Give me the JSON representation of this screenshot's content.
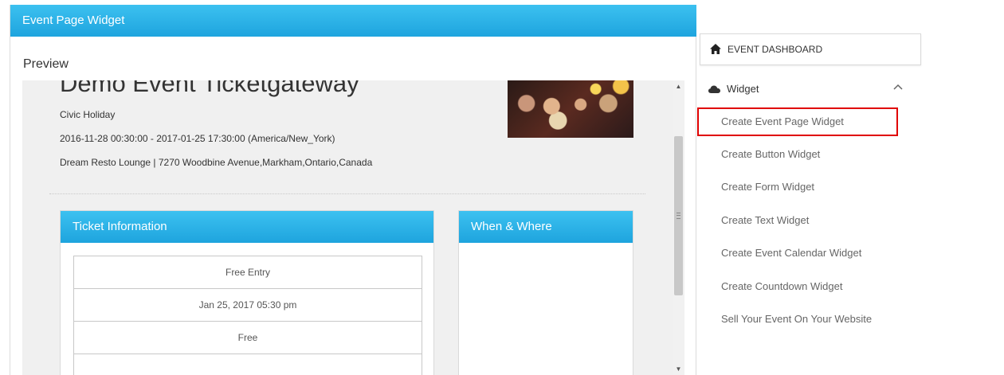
{
  "panel": {
    "title": "Event Page Widget",
    "preview_label": "Preview"
  },
  "event": {
    "title": "Demo Event Ticketgateway",
    "category": "Civic Holiday",
    "datetime": "2016-11-28 00:30:00 - 2017-01-25 17:30:00 (America/New_York)",
    "venue": "Dream Resto Lounge | 7270 Woodbine Avenue,Markham,Ontario,Canada"
  },
  "ticket_card": {
    "title": "Ticket Information",
    "rows": [
      "Free Entry",
      "Jan 25, 2017 05:30 pm",
      "Free",
      ""
    ]
  },
  "when_where_card": {
    "title": "When & Where"
  },
  "sidebar": {
    "dashboard_label": "EVENT DASHBOARD",
    "widget_label": "Widget",
    "items": [
      "Create Event Page Widget",
      "Create Button Widget",
      "Create Form Widget",
      "Create Text Widget",
      "Create Event Calendar Widget",
      "Create Countdown Widget",
      "Sell Your Event On Your Website"
    ]
  },
  "colors": {
    "header_blue": "#1ea4de",
    "highlight_red": "#e00000"
  }
}
